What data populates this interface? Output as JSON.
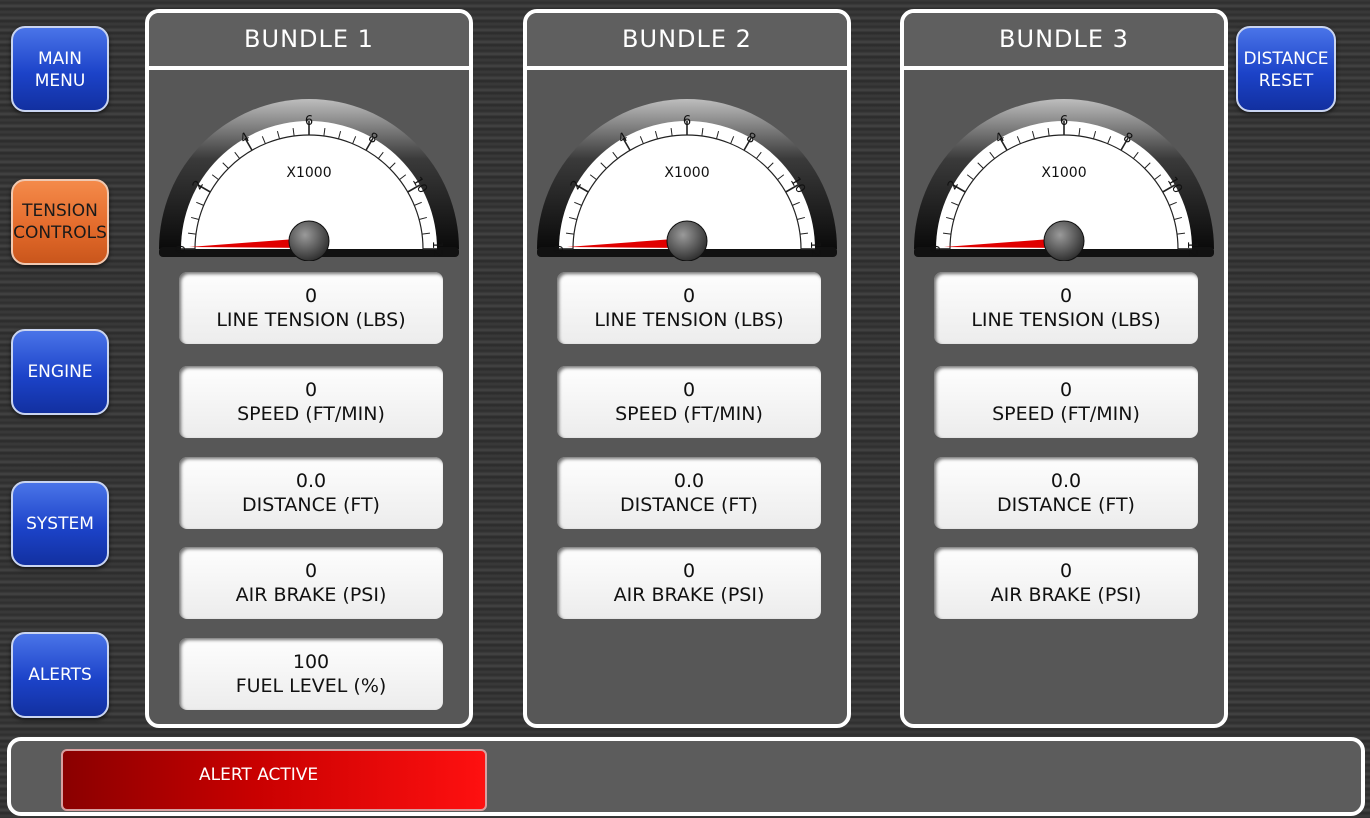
{
  "nav": {
    "main_menu": "MAIN\nMENU",
    "tension_controls": "TENSION\nCONTROLS",
    "engine": "ENGINE",
    "system": "SYSTEM",
    "alerts": "ALERTS",
    "distance_reset": "DISTANCE\nRESET"
  },
  "gauge": {
    "multiplier_label": "X1000",
    "ticks": [
      "0",
      "2",
      "4",
      "6",
      "8",
      "10",
      "12"
    ],
    "max": 12
  },
  "bundles": [
    {
      "title": "BUNDLE 1",
      "gauge_value": 0,
      "line_tension": {
        "value": "0",
        "label": "LINE TENSION (LBS)"
      },
      "speed": {
        "value": "0",
        "label": "SPEED (FT/MIN)"
      },
      "distance": {
        "value": "0.0",
        "label": "DISTANCE (FT)"
      },
      "air_brake": {
        "value": "0",
        "label": "AIR BRAKE (PSI)"
      },
      "fuel_level": {
        "value": "100",
        "label": "FUEL LEVEL (%)"
      }
    },
    {
      "title": "BUNDLE 2",
      "gauge_value": 0,
      "line_tension": {
        "value": "0",
        "label": "LINE TENSION (LBS)"
      },
      "speed": {
        "value": "0",
        "label": "SPEED (FT/MIN)"
      },
      "distance": {
        "value": "0.0",
        "label": "DISTANCE (FT)"
      },
      "air_brake": {
        "value": "0",
        "label": "AIR BRAKE (PSI)"
      }
    },
    {
      "title": "BUNDLE 3",
      "gauge_value": 0,
      "line_tension": {
        "value": "0",
        "label": "LINE TENSION (LBS)"
      },
      "speed": {
        "value": "0",
        "label": "SPEED (FT/MIN)"
      },
      "distance": {
        "value": "0.0",
        "label": "DISTANCE (FT)"
      },
      "air_brake": {
        "value": "0",
        "label": "AIR BRAKE (PSI)"
      }
    }
  ],
  "status": {
    "alert_text": "ALERT ACTIVE"
  },
  "colors": {
    "nav_blue": "#1c43c9",
    "nav_active_orange": "#e2692a",
    "alert_red": "#e00000",
    "needle_red": "#e00000"
  }
}
